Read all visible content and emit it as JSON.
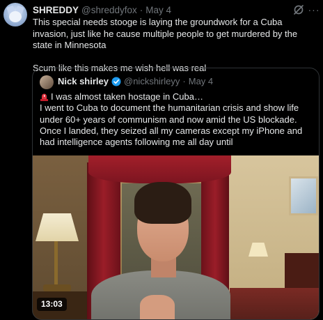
{
  "post": {
    "display_name": "SHREDDY",
    "handle": "@shreddyfox",
    "separator": "·",
    "date": "May 4",
    "text_line_1": "This special needs stooge is laying the groundwork for a Cuba invasion, just like he cause multiple people to get murdered by the state in Minnesota",
    "text_line_2": "Scum like this makes me wish hell was real",
    "icons": {
      "avatar": "fox-avatar",
      "grok": "grok-icon",
      "more": "more-icon"
    }
  },
  "quote": {
    "display_name": "Nick shirley",
    "handle": "@nickshirleyy",
    "separator": "·",
    "date": "May 4",
    "verified": true,
    "text_line_1": "I was almost taken hostage in Cuba…",
    "text_line_2": "I went to Cuba to document the humanitarian crisis and show life under 60+ years of communism and now amid the US blockade. Once I landed, they seized all my cameras except my iPhone and had intelligence agents following me all day until",
    "icons": {
      "siren": "siren-icon",
      "verified": "verified-badge-icon"
    },
    "video": {
      "timestamp": "13:03"
    }
  },
  "colors": {
    "background": "#000000",
    "text": "#e7e9ea",
    "muted": "#71767b",
    "border": "#2f3336",
    "verified": "#1d9bf0"
  }
}
